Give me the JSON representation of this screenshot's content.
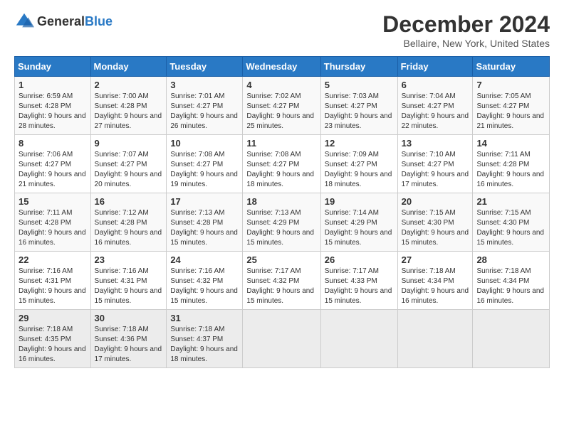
{
  "header": {
    "logo_general": "General",
    "logo_blue": "Blue",
    "title": "December 2024",
    "subtitle": "Bellaire, New York, United States"
  },
  "calendar": {
    "days_of_week": [
      "Sunday",
      "Monday",
      "Tuesday",
      "Wednesday",
      "Thursday",
      "Friday",
      "Saturday"
    ],
    "weeks": [
      [
        null,
        {
          "day": "2",
          "sunrise": "7:00 AM",
          "sunset": "4:28 PM",
          "daylight": "9 hours and 27 minutes."
        },
        {
          "day": "3",
          "sunrise": "7:01 AM",
          "sunset": "4:27 PM",
          "daylight": "9 hours and 26 minutes."
        },
        {
          "day": "4",
          "sunrise": "7:02 AM",
          "sunset": "4:27 PM",
          "daylight": "9 hours and 25 minutes."
        },
        {
          "day": "5",
          "sunrise": "7:03 AM",
          "sunset": "4:27 PM",
          "daylight": "9 hours and 23 minutes."
        },
        {
          "day": "6",
          "sunrise": "7:04 AM",
          "sunset": "4:27 PM",
          "daylight": "9 hours and 22 minutes."
        },
        {
          "day": "7",
          "sunrise": "7:05 AM",
          "sunset": "4:27 PM",
          "daylight": "9 hours and 21 minutes."
        }
      ],
      [
        {
          "day": "1",
          "sunrise": "6:59 AM",
          "sunset": "4:28 PM",
          "daylight": "9 hours and 28 minutes."
        },
        {
          "day": "9",
          "sunrise": "7:07 AM",
          "sunset": "4:27 PM",
          "daylight": "9 hours and 20 minutes."
        },
        {
          "day": "10",
          "sunrise": "7:08 AM",
          "sunset": "4:27 PM",
          "daylight": "9 hours and 19 minutes."
        },
        {
          "day": "11",
          "sunrise": "7:08 AM",
          "sunset": "4:27 PM",
          "daylight": "9 hours and 18 minutes."
        },
        {
          "day": "12",
          "sunrise": "7:09 AM",
          "sunset": "4:27 PM",
          "daylight": "9 hours and 18 minutes."
        },
        {
          "day": "13",
          "sunrise": "7:10 AM",
          "sunset": "4:27 PM",
          "daylight": "9 hours and 17 minutes."
        },
        {
          "day": "14",
          "sunrise": "7:11 AM",
          "sunset": "4:28 PM",
          "daylight": "9 hours and 16 minutes."
        }
      ],
      [
        {
          "day": "8",
          "sunrise": "7:06 AM",
          "sunset": "4:27 PM",
          "daylight": "9 hours and 21 minutes."
        },
        {
          "day": "16",
          "sunrise": "7:12 AM",
          "sunset": "4:28 PM",
          "daylight": "9 hours and 16 minutes."
        },
        {
          "day": "17",
          "sunrise": "7:13 AM",
          "sunset": "4:28 PM",
          "daylight": "9 hours and 15 minutes."
        },
        {
          "day": "18",
          "sunrise": "7:13 AM",
          "sunset": "4:29 PM",
          "daylight": "9 hours and 15 minutes."
        },
        {
          "day": "19",
          "sunrise": "7:14 AM",
          "sunset": "4:29 PM",
          "daylight": "9 hours and 15 minutes."
        },
        {
          "day": "20",
          "sunrise": "7:15 AM",
          "sunset": "4:30 PM",
          "daylight": "9 hours and 15 minutes."
        },
        {
          "day": "21",
          "sunrise": "7:15 AM",
          "sunset": "4:30 PM",
          "daylight": "9 hours and 15 minutes."
        }
      ],
      [
        {
          "day": "15",
          "sunrise": "7:11 AM",
          "sunset": "4:28 PM",
          "daylight": "9 hours and 16 minutes."
        },
        {
          "day": "23",
          "sunrise": "7:16 AM",
          "sunset": "4:31 PM",
          "daylight": "9 hours and 15 minutes."
        },
        {
          "day": "24",
          "sunrise": "7:16 AM",
          "sunset": "4:32 PM",
          "daylight": "9 hours and 15 minutes."
        },
        {
          "day": "25",
          "sunrise": "7:17 AM",
          "sunset": "4:32 PM",
          "daylight": "9 hours and 15 minutes."
        },
        {
          "day": "26",
          "sunrise": "7:17 AM",
          "sunset": "4:33 PM",
          "daylight": "9 hours and 15 minutes."
        },
        {
          "day": "27",
          "sunrise": "7:18 AM",
          "sunset": "4:34 PM",
          "daylight": "9 hours and 16 minutes."
        },
        {
          "day": "28",
          "sunrise": "7:18 AM",
          "sunset": "4:34 PM",
          "daylight": "9 hours and 16 minutes."
        }
      ],
      [
        {
          "day": "22",
          "sunrise": "7:16 AM",
          "sunset": "4:31 PM",
          "daylight": "9 hours and 15 minutes."
        },
        {
          "day": "30",
          "sunrise": "7:18 AM",
          "sunset": "4:36 PM",
          "daylight": "9 hours and 17 minutes."
        },
        {
          "day": "31",
          "sunrise": "7:18 AM",
          "sunset": "4:37 PM",
          "daylight": "9 hours and 18 minutes."
        },
        null,
        null,
        null,
        null
      ],
      [
        {
          "day": "29",
          "sunrise": "7:18 AM",
          "sunset": "4:35 PM",
          "daylight": "9 hours and 16 minutes."
        },
        null,
        null,
        null,
        null,
        null,
        null
      ]
    ]
  }
}
